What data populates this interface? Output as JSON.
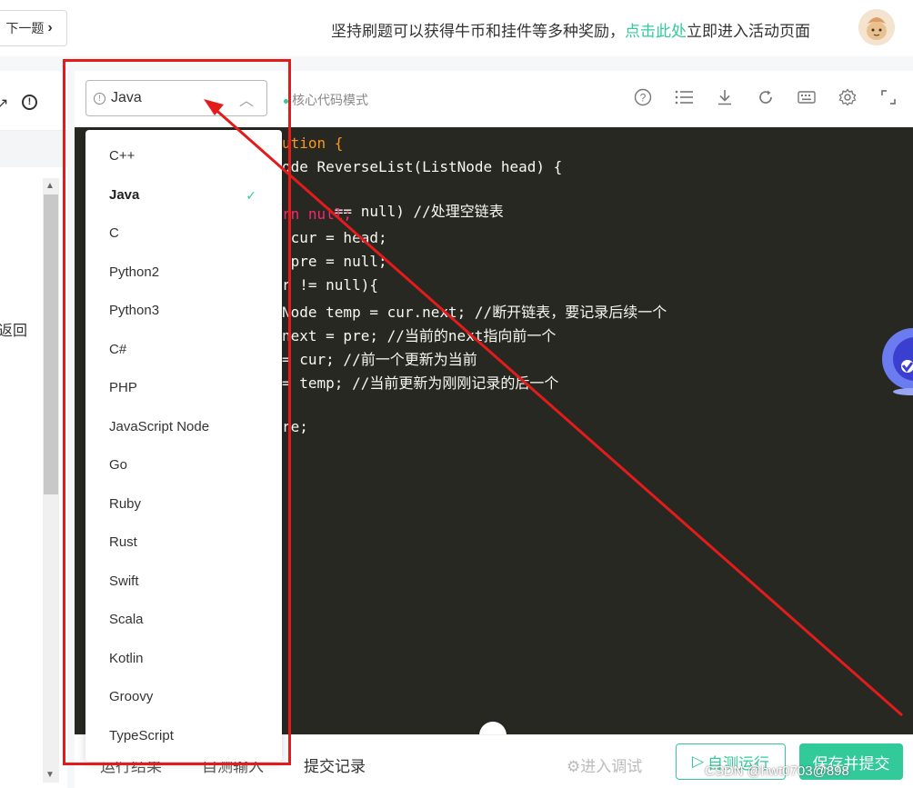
{
  "header": {
    "next_label": "下一题",
    "promo_prefix": "坚持刷题可以获得牛币和挂件等多种奖励，",
    "promo_link": "点击此处",
    "promo_suffix": "立即进入活动页面"
  },
  "left_panel": {
    "partial_text": "返回"
  },
  "editor": {
    "language": "Java",
    "mode_label": "核心代码模式",
    "toolbar_icons": [
      "help-icon",
      "list-icon",
      "download-icon",
      "refresh-icon",
      "keyboard-icon",
      "gear-icon",
      "fullscreen-icon"
    ],
    "code_lines": [
      "ution {",
      "ode ReverseList(ListNode head) {",
      "== null) //处理空链表",
      "rn null;",
      " cur = head;",
      " pre = null;",
      "r != null){",
      "Node temp = cur.next; //断开链表，要记录后续一个",
      "next = pre; //当前的next指向前一个",
      "= cur; //前一个更新为当前",
      "= temp; //当前更新为刚刚记录的后一个",
      "",
      "re;"
    ]
  },
  "dropdown": {
    "items": [
      "C++",
      "Java",
      "C",
      "Python2",
      "Python3",
      "C#",
      "PHP",
      "JavaScript Node",
      "Go",
      "Ruby",
      "Rust",
      "Swift",
      "Scala",
      "Kotlin",
      "Groovy",
      "TypeScript"
    ],
    "selected": "Java"
  },
  "bottom": {
    "tab_results": "运行结果",
    "tab_custom_input": "自测输入",
    "tab_records": "提交记录",
    "debug_label": "进入调试",
    "run_label": "自测运行",
    "submit_label": "保存并提交"
  },
  "watermark": "CSDN @hwt0703@898",
  "colors": {
    "accent": "#32ca99",
    "annotation_red": "#e31b1b",
    "editor_bg": "#272822"
  }
}
